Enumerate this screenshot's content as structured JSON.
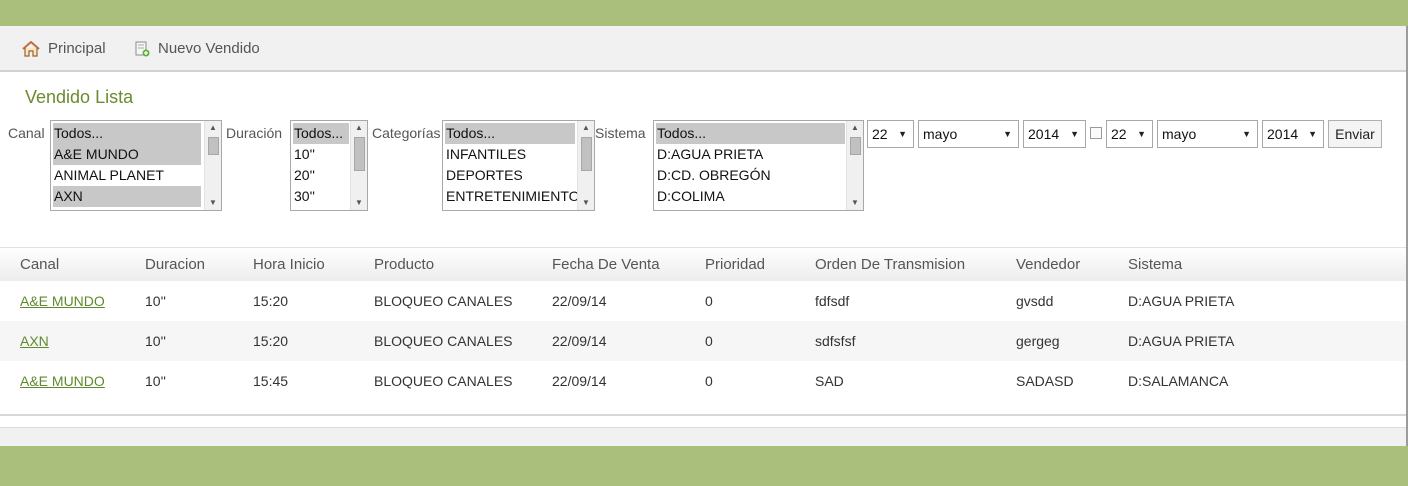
{
  "nav": {
    "home_label": "Principal",
    "new_label": "Nuevo Vendido"
  },
  "page_title": "Vendido Lista",
  "filters": {
    "canal": {
      "label": "Canal",
      "options": [
        "Todos...",
        "A&E MUNDO",
        "ANIMAL PLANET",
        "AXN"
      ]
    },
    "duracion": {
      "label": "Duración",
      "options": [
        "Todos...",
        "10''",
        "20''",
        "30''"
      ]
    },
    "categorias": {
      "label": "Categorías",
      "options": [
        "Todos...",
        "INFANTILES",
        "DEPORTES",
        "ENTRETENIMIENTO"
      ]
    },
    "sistema": {
      "label": "Sistema",
      "options": [
        "Todos...",
        "D:AGUA PRIETA",
        "D:CD. OBREGÓN",
        "D:COLIMA"
      ]
    },
    "from_day": "22",
    "from_month": "mayo",
    "from_year": "2014",
    "to_day": "22",
    "to_month": "mayo",
    "to_year": "2014",
    "submit_label": "Enviar"
  },
  "table": {
    "headers": [
      "Canal",
      "Duracion",
      "Hora Inicio",
      "Producto",
      "Fecha De Venta",
      "Prioridad",
      "Orden De Transmision",
      "Vendedor",
      "Sistema"
    ],
    "rows": [
      [
        "A&E MUNDO",
        "10''",
        "15:20",
        "BLOQUEO CANALES",
        "22/09/14",
        "0",
        "fdfsdf",
        "gvsdd",
        "D:AGUA PRIETA"
      ],
      [
        "AXN",
        "10''",
        "15:20",
        "BLOQUEO CANALES",
        "22/09/14",
        "0",
        "sdfsfsf",
        "gergeg",
        "D:AGUA PRIETA"
      ],
      [
        "A&E MUNDO",
        "10''",
        "15:45",
        "BLOQUEO CANALES",
        "22/09/14",
        "0",
        "SAD",
        "SADASD",
        "D:SALAMANCA"
      ]
    ]
  },
  "colors": {
    "header_bar": "#a9bf7b",
    "accent_text": "#6a8b2f",
    "link": "#5f8a2b"
  },
  "icons": {
    "home": "home-icon",
    "new": "add-document-icon"
  }
}
